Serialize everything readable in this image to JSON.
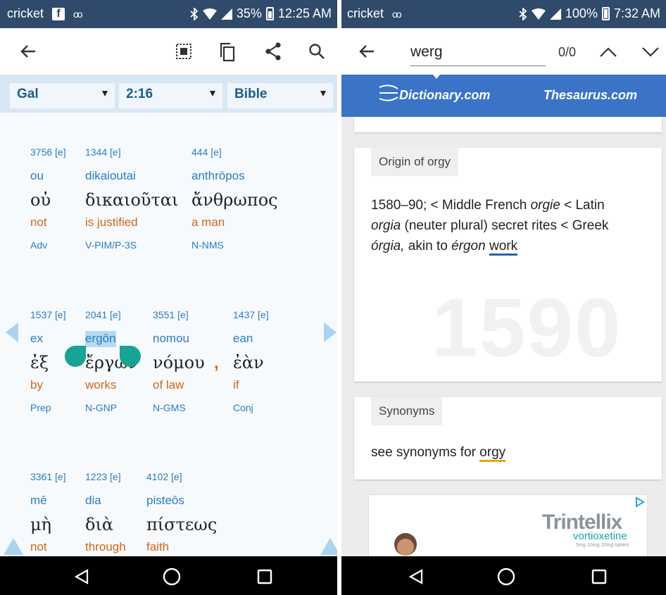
{
  "left": {
    "status": {
      "carrier": "cricket",
      "fb_icon": "f",
      "voicemail": "oo",
      "battery": "35%",
      "time": "12:25 AM"
    },
    "appbar": {
      "icons": [
        "back-arrow-icon",
        "select-all-icon",
        "copy-icon",
        "share-icon",
        "search-icon"
      ]
    },
    "selectors": {
      "book": "Gal",
      "chapter_verse": "2:16",
      "version": "Bible"
    },
    "rows": [
      [
        {
          "num": "3756 [e]",
          "translit": "ou",
          "greek": "οὐ",
          "english": "not",
          "parse": "Adv"
        },
        {
          "num": "1344 [e]",
          "translit": "dikaioutai",
          "greek": "δικαιοῦται",
          "english": "is justified",
          "parse": "V-PIM/P-3S"
        },
        {
          "num": "444 [e]",
          "translit": "anthrōpos",
          "greek": "ἄνθρωπος",
          "english": "a man",
          "parse": "N-NMS"
        }
      ],
      [
        {
          "num": "1537 [e]",
          "translit": "ex",
          "greek": "ἐξ",
          "english": "by",
          "parse": "Prep"
        },
        {
          "num": "2041 [e]",
          "translit": "ergōn",
          "greek": "ἔργων",
          "english": "works",
          "parse": "N-GNP"
        },
        {
          "num": "3551 [e]",
          "translit": "nomou",
          "greek": "νόμου",
          "english": "of law",
          "parse": "N-GMS"
        },
        {
          "num": "1437 [e]",
          "translit": "ean",
          "greek": "ἐὰν",
          "english": "if",
          "parse": "Conj"
        }
      ],
      [
        {
          "num": "3361 [e]",
          "translit": "mē",
          "greek": "μὴ",
          "english": "not",
          "parse": ""
        },
        {
          "num": "1223 [e]",
          "translit": "dia",
          "greek": "διὰ",
          "english": "through",
          "parse": ""
        },
        {
          "num": "4102 [e]",
          "translit": "pisteōs",
          "greek": "πίστεως",
          "english": "faith",
          "parse": ""
        }
      ]
    ],
    "comma": ","
  },
  "right": {
    "status": {
      "carrier": "cricket",
      "voicemail": "oo",
      "battery": "100%",
      "time": "7:32 AM"
    },
    "find": {
      "query": "werg",
      "count": "0/0"
    },
    "brand": {
      "dictionary": "Dictionary.com",
      "thesaurus": "Thesaurus.com"
    },
    "origin": {
      "chip": "Origin of orgy",
      "line1": "1580–90; < Middle French ",
      "line1_it": "orgie",
      "line1_end": " < Latin",
      "line2_it": "orgia",
      "line2": " (neuter plural) secret rites < Greek",
      "line3_it1": "órgia,",
      "line3_mid": " akin to ",
      "line3_it2": "érgon",
      "line3_sp": " ",
      "line3_link": "work",
      "watermark": "1590"
    },
    "synonyms": {
      "chip": "Synonyms",
      "text": "see synonyms for ",
      "link": "orgy"
    },
    "ad": {
      "brand": "Trintellix",
      "generic": "vortioxetine",
      "dosage": "5mg·10mg·20mg tablets"
    }
  },
  "colors": {
    "statusbar": "#2f4a6b",
    "selector_bar": "#d8e7f4",
    "blue_text": "#2a7bc0",
    "orange_text": "#d2651a",
    "handle": "#18a394",
    "dict_blue": "#3b73c6"
  }
}
